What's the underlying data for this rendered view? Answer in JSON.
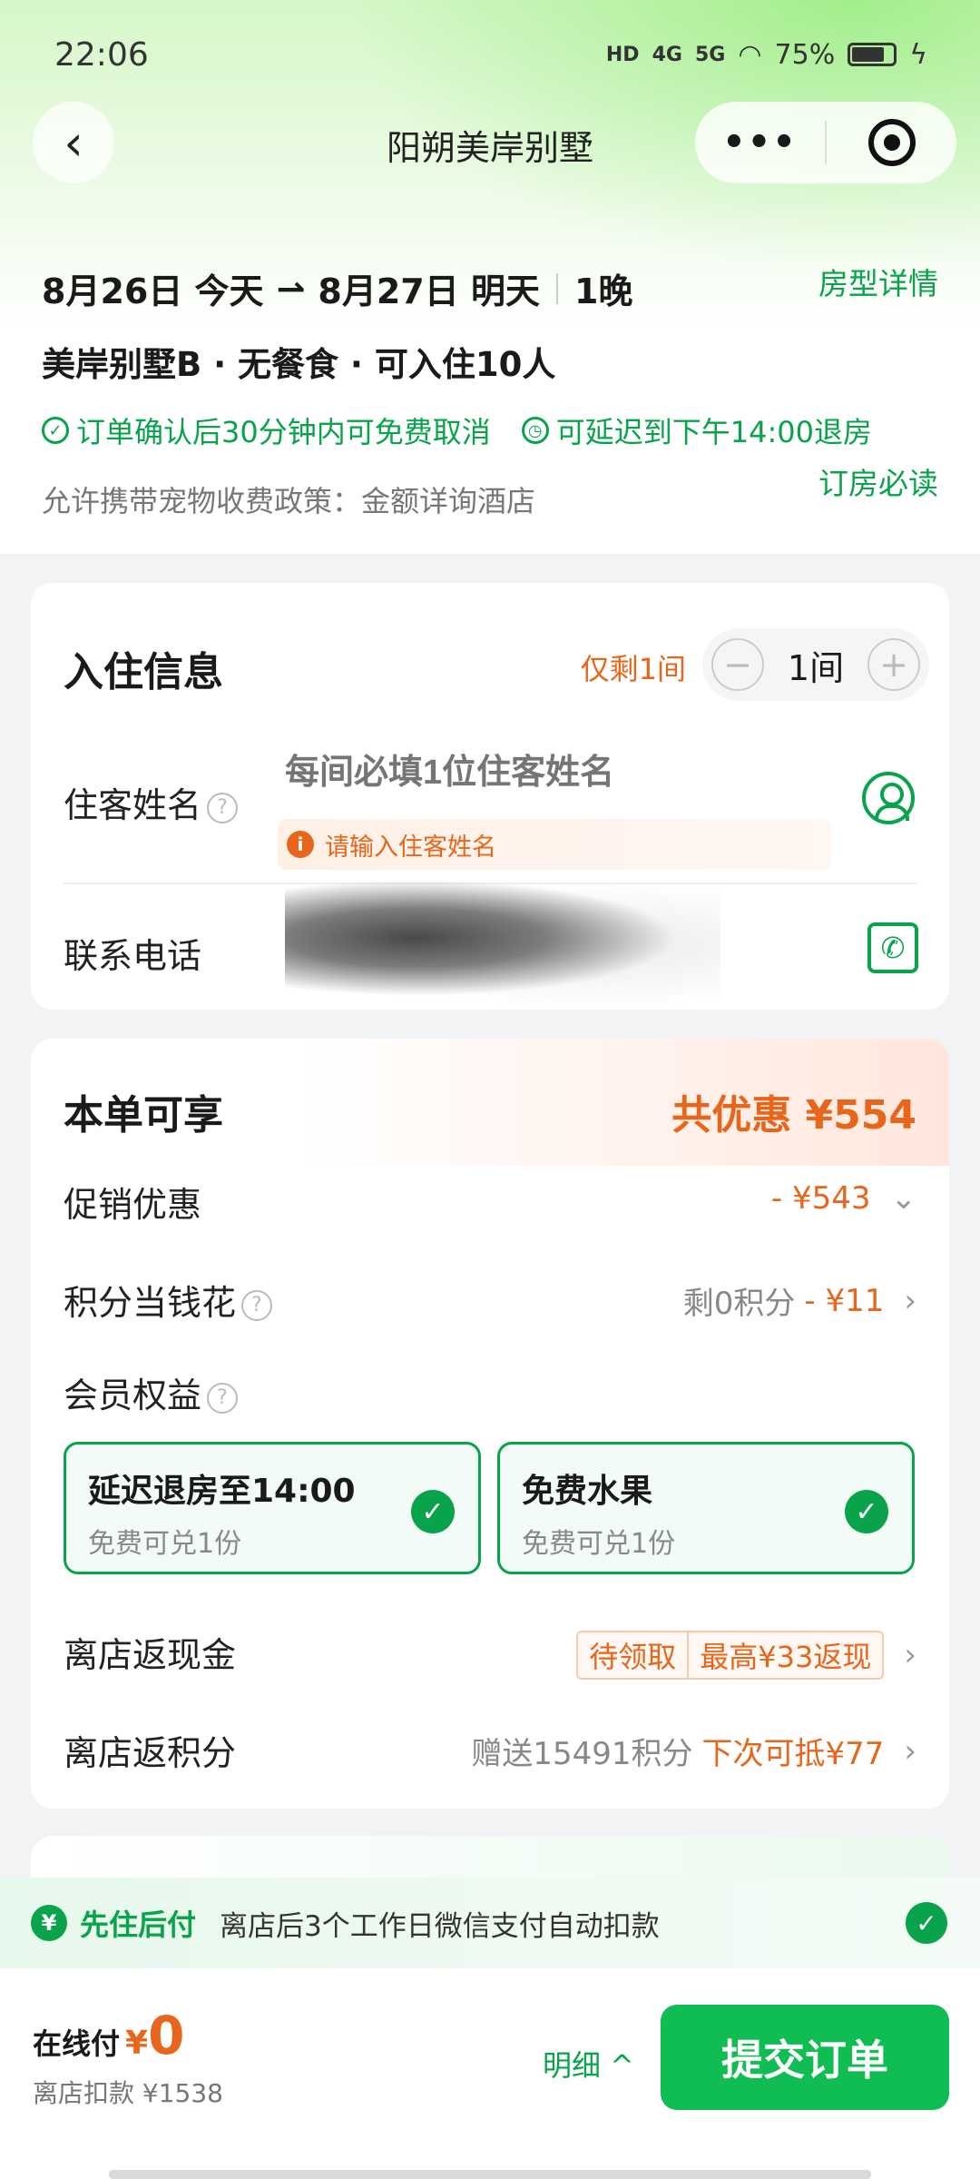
{
  "status_bar": {
    "time": "22:06",
    "net1": "HD",
    "net2": "4G",
    "net3": "5G",
    "battery": "75%"
  },
  "nav": {
    "title": "阳朔美岸别墅",
    "more": "•••"
  },
  "header": {
    "checkin": "8月26日 今天",
    "arrow": "⇀",
    "checkout": "8月27日 明天",
    "nights": "1晚",
    "room_type_link": "房型详情",
    "room_desc": "美岸别墅B · 无餐食 · 可入住10人",
    "cancel_policy": "订单确认后30分钟内可免费取消",
    "late_checkout": "可延迟到下午14:00退房",
    "pet_policy": "允许携带宠物收费政策：金额详询酒店",
    "must_read_link": "订房必读"
  },
  "checkin_info": {
    "title": "入住信息",
    "remaining": "仅剩1间",
    "rooms_count": "1间",
    "minus": "−",
    "plus": "+",
    "guest_label": "住客姓名",
    "guest_placeholder": "每间必填1位住客姓名",
    "guest_warning": "请输入住客姓名",
    "phone_label": "联系电话",
    "phone_value": ""
  },
  "discounts": {
    "title": "本单可享",
    "total_saving": "共优惠 ¥554",
    "promo_label": "促销优惠",
    "promo_value": "- ¥543",
    "points_label": "积分当钱花",
    "points_left": "剩0积分",
    "points_value": "- ¥11",
    "member_label": "会员权益",
    "benefits": [
      {
        "title": "延迟退房至14:00",
        "sub": "免费可兑1份"
      },
      {
        "title": "免费水果",
        "sub": "免费可兑1份"
      }
    ],
    "cashback_label": "离店返现金",
    "cashback_tag1": "待领取",
    "cashback_tag2": "最高¥33返现",
    "points_back_label": "离店返积分",
    "points_back_gift": "赠送15491积分",
    "points_back_value": "下次可抵¥77"
  },
  "pay_later": {
    "title": "先住后付",
    "desc": "离店后3个工作日微信支付自动扣款"
  },
  "bottom": {
    "online_label": "在线付",
    "currency": "¥",
    "online_amount": "0",
    "store_deduct": "离店扣款 ¥1538",
    "detail": "明细 ^",
    "submit": "提交订单"
  },
  "colors": {
    "brand_green": "#08a34a",
    "orange": "#e8661b",
    "button_green": "#0fbd52"
  }
}
